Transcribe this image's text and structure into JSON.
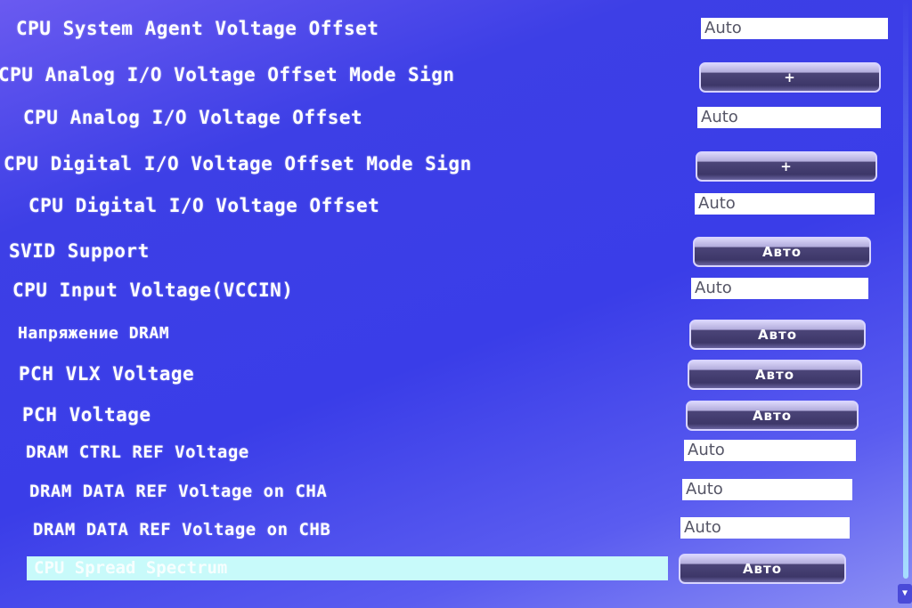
{
  "settings": [
    {
      "label": "CPU System Agent Voltage Offset",
      "type": "field",
      "value": "Auto"
    },
    {
      "label": "CPU Analog I/O Voltage Offset Mode Sign",
      "type": "button",
      "value": "+"
    },
    {
      "label": "CPU Analog I/O Voltage Offset",
      "type": "field",
      "value": "Auto"
    },
    {
      "label": "CPU Digital I/O Voltage Offset Mode Sign",
      "type": "button",
      "value": "+"
    },
    {
      "label": "CPU Digital I/O Voltage Offset",
      "type": "field",
      "value": "Auto"
    },
    {
      "label": "SVID Support",
      "type": "button",
      "value": "Авто"
    },
    {
      "label": "CPU Input Voltage(VCCIN)",
      "type": "field",
      "value": "Auto"
    },
    {
      "label": "Напряжение DRAM",
      "type": "button",
      "value": "Авто"
    },
    {
      "label": "PCH VLX Voltage",
      "type": "button",
      "value": "Авто"
    },
    {
      "label": "PCH Voltage",
      "type": "button",
      "value": "Авто"
    },
    {
      "label": "DRAM CTRL REF Voltage",
      "type": "field",
      "value": "Auto"
    },
    {
      "label": "DRAM DATA REF Voltage on CHA",
      "type": "field",
      "value": "Auto"
    },
    {
      "label": "DRAM DATA REF Voltage on CHB",
      "type": "field",
      "value": "Auto"
    },
    {
      "label": "CPU Spread Spectrum",
      "type": "button",
      "value": "Авто",
      "selected": true
    }
  ],
  "scrollbar": {
    "arrow_icon": "arrow-down"
  },
  "colors": {
    "background": "#3d3fe6",
    "selection": "#c8fafa",
    "button_dark": "#3d3768"
  }
}
